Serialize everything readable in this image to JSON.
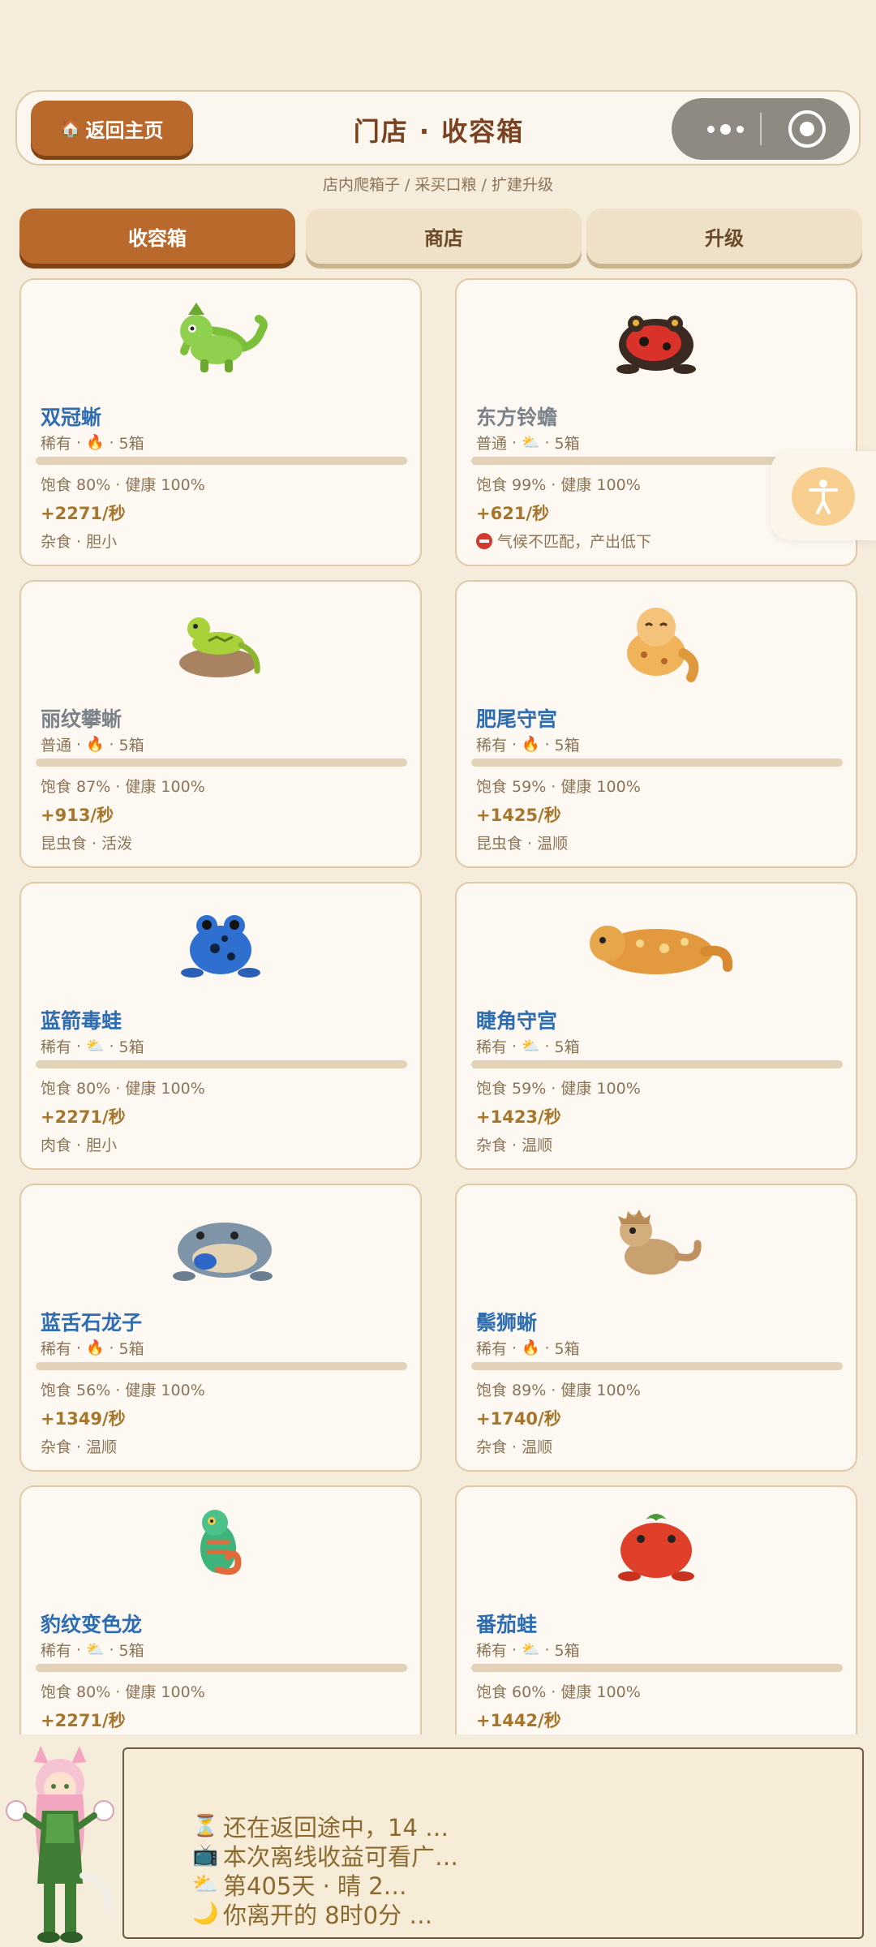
{
  "header": {
    "back_label": "返回主页",
    "title": "门店 · 收容箱",
    "subtitle": "店内爬箱子 / 采买口粮 / 扩建升级"
  },
  "tabs": [
    {
      "label": "收容箱",
      "active": true
    },
    {
      "label": "商店",
      "active": false
    },
    {
      "label": "升级",
      "active": false
    }
  ],
  "cards": [
    {
      "name": "双冠蜥",
      "rarity": "稀有",
      "climate_icon": "fire",
      "boxes": "5箱",
      "stats": "饱食 80% · 健康 100%",
      "rate": "+2271/秒",
      "traits": "杂食 · 胆小",
      "warning": false
    },
    {
      "name": "东方铃蟾",
      "rarity": "普通",
      "climate_icon": "sun-cloud",
      "boxes": "5箱",
      "stats": "饱食 99% · 健康 100%",
      "rate": "+621/秒",
      "traits": "气候不匹配，产出低下",
      "warning": true
    },
    {
      "name": "丽纹攀蜥",
      "rarity": "普通",
      "climate_icon": "fire",
      "boxes": "5箱",
      "stats": "饱食 87% · 健康 100%",
      "rate": "+913/秒",
      "traits": "昆虫食 · 活泼",
      "warning": false
    },
    {
      "name": "肥尾守宫",
      "rarity": "稀有",
      "climate_icon": "fire",
      "boxes": "5箱",
      "stats": "饱食 59% · 健康 100%",
      "rate": "+1425/秒",
      "traits": "昆虫食 · 温顺",
      "warning": false
    },
    {
      "name": "蓝箭毒蛙",
      "rarity": "稀有",
      "climate_icon": "sun-cloud",
      "boxes": "5箱",
      "stats": "饱食 80% · 健康 100%",
      "rate": "+2271/秒",
      "traits": "肉食 · 胆小",
      "warning": false
    },
    {
      "name": "睫角守宫",
      "rarity": "稀有",
      "climate_icon": "sun-cloud",
      "boxes": "5箱",
      "stats": "饱食 59% · 健康 100%",
      "rate": "+1423/秒",
      "traits": "杂食 · 温顺",
      "warning": false
    },
    {
      "name": "蓝舌石龙子",
      "rarity": "稀有",
      "climate_icon": "fire",
      "boxes": "5箱",
      "stats": "饱食 56% · 健康 100%",
      "rate": "+1349/秒",
      "traits": "杂食 · 温顺",
      "warning": false
    },
    {
      "name": "鬃狮蜥",
      "rarity": "稀有",
      "climate_icon": "fire",
      "boxes": "5箱",
      "stats": "饱食 89% · 健康 100%",
      "rate": "+1740/秒",
      "traits": "杂食 · 温顺",
      "warning": false
    },
    {
      "name": "豹纹变色龙",
      "rarity": "稀有",
      "climate_icon": "sun-cloud",
      "boxes": "5箱",
      "stats": "饱食 80% · 健康 100%",
      "rate": "+2271/秒",
      "traits": "",
      "warning": false
    },
    {
      "name": "番茄蛙",
      "rarity": "稀有",
      "climate_icon": "sun-cloud",
      "boxes": "5箱",
      "stats": "饱食 60% · 健康 100%",
      "rate": "+1442/秒",
      "traits": "",
      "warning": false
    }
  ],
  "status": {
    "lines": [
      {
        "icon": "⏳",
        "text": "还在返回途中，14 …"
      },
      {
        "icon": "📺",
        "text": "本次离线收益可看广…"
      },
      {
        "icon": "⛅",
        "text": "第405天 · 晴 2…"
      },
      {
        "icon": "🌙",
        "text": "你离开的 8时0分 …"
      }
    ]
  },
  "colors": {
    "accent": "#b8692b",
    "background": "#f6ecdc",
    "name_blue": "#2f6db2",
    "rate_gold": "#a5762b"
  }
}
